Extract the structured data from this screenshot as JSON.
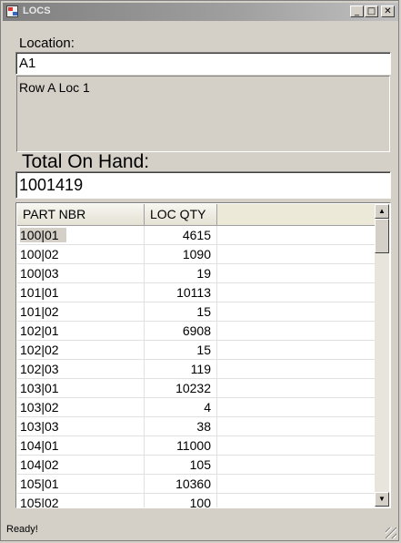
{
  "window": {
    "title": "LOCS"
  },
  "titlebar_buttons": {
    "minimize": "_",
    "maximize": "□",
    "close": "✕"
  },
  "location": {
    "label": "Location:",
    "value": "A1",
    "description": "Row A Loc 1"
  },
  "total": {
    "label": "Total On Hand:",
    "value": "1001419"
  },
  "grid": {
    "headers": [
      "PART NBR",
      "LOC QTY"
    ],
    "rows": [
      {
        "part": "100|01",
        "qty": "4615"
      },
      {
        "part": "100|02",
        "qty": "1090"
      },
      {
        "part": "100|03",
        "qty": "19"
      },
      {
        "part": "101|01",
        "qty": "10113"
      },
      {
        "part": "101|02",
        "qty": "15"
      },
      {
        "part": "102|01",
        "qty": "6908"
      },
      {
        "part": "102|02",
        "qty": "15"
      },
      {
        "part": "102|03",
        "qty": "119"
      },
      {
        "part": "103|01",
        "qty": "10232"
      },
      {
        "part": "103|02",
        "qty": "4"
      },
      {
        "part": "103|03",
        "qty": "38"
      },
      {
        "part": "104|01",
        "qty": "11000"
      },
      {
        "part": "104|02",
        "qty": "105"
      },
      {
        "part": "105|01",
        "qty": "10360"
      },
      {
        "part": "105|02",
        "qty": "100"
      }
    ],
    "selected_row": 0
  },
  "status": {
    "text": "Ready!"
  }
}
